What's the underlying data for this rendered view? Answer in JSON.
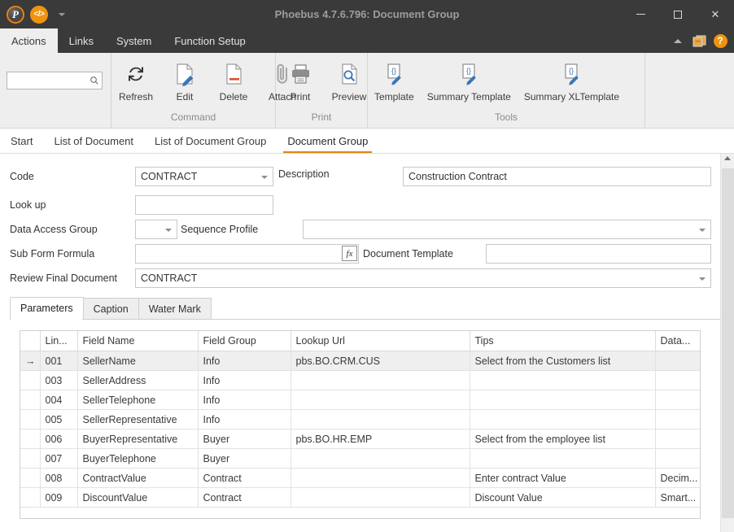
{
  "window": {
    "title": "Phoebus 4.7.6.796: Document Group",
    "minimize_label": "─",
    "maximize_label": "□",
    "close_label": "✕",
    "quick_access": [
      {
        "name": "app-logo-icon",
        "glyph": "P"
      },
      {
        "name": "code-icon",
        "glyph": "</>"
      }
    ]
  },
  "menubar": {
    "items": [
      {
        "label": "Actions",
        "active": true
      },
      {
        "label": "Links",
        "active": false
      },
      {
        "label": "System",
        "active": false
      },
      {
        "label": "Function Setup",
        "active": false
      }
    ],
    "collapse_icon": "chevron-up-icon",
    "windows_icon": "cascade-windows-icon",
    "help_label": "?"
  },
  "ribbon": {
    "search": {
      "value": "",
      "placeholder": "",
      "icon": "search-icon"
    },
    "groups": [
      {
        "title": "Command",
        "buttons": [
          {
            "label": "Refresh",
            "icon": "refresh-icon"
          },
          {
            "label": "Edit",
            "icon": "edit-document-icon"
          },
          {
            "label": "Delete",
            "icon": "delete-document-icon"
          },
          {
            "label": "Attach",
            "icon": "paperclip-icon"
          }
        ]
      },
      {
        "title": "Print",
        "buttons": [
          {
            "label": "Print",
            "icon": "printer-icon"
          },
          {
            "label": "Preview",
            "icon": "print-preview-icon"
          }
        ]
      },
      {
        "title": "Tools",
        "buttons": [
          {
            "label": "Template",
            "icon": "template-edit-icon"
          },
          {
            "label": "Summary Template",
            "icon": "template-edit-icon"
          },
          {
            "label": "Summary XLTemplate",
            "icon": "template-edit-icon"
          }
        ]
      }
    ]
  },
  "document_tabs": [
    {
      "label": "Start",
      "active": false
    },
    {
      "label": "List of Document",
      "active": false
    },
    {
      "label": "List of Document Group",
      "active": false
    },
    {
      "label": "Document Group",
      "active": true
    }
  ],
  "form": {
    "code_label": "Code",
    "code_value": "CONTRACT",
    "description_label": "Description",
    "description_value": "Construction Contract",
    "lookup_label": "Look up",
    "lookup_value": "",
    "data_access_group_label": "Data Access Group",
    "data_access_group_value": "",
    "sequence_profile_label": "Sequence Profile",
    "sequence_profile_value": "",
    "sub_form_formula_label": "Sub Form Formula",
    "sub_form_formula_value": "",
    "formula_button_label": "fx",
    "document_template_label": "Document Template",
    "document_template_value": "",
    "review_final_document_label": "Review Final Document",
    "review_final_document_value": "CONTRACT"
  },
  "inner_tabs": [
    {
      "label": "Parameters",
      "active": true
    },
    {
      "label": "Caption",
      "active": false
    },
    {
      "label": "Water Mark",
      "active": false
    }
  ],
  "grid": {
    "columns": [
      "",
      "Lin...",
      "Field Name",
      "Field Group",
      "Lookup Url",
      "Tips",
      "Data..."
    ],
    "row_marker": "→",
    "rows": [
      {
        "selected": true,
        "line": "001",
        "field_name": "SellerName",
        "field_group": "Info",
        "lookup_url": "pbs.BO.CRM.CUS",
        "tips": "Select from the Customers list",
        "data": ""
      },
      {
        "selected": false,
        "line": "003",
        "field_name": "SellerAddress",
        "field_group": "Info",
        "lookup_url": "",
        "tips": "",
        "data": ""
      },
      {
        "selected": false,
        "line": "004",
        "field_name": "SellerTelephone",
        "field_group": "Info",
        "lookup_url": "",
        "tips": "",
        "data": ""
      },
      {
        "selected": false,
        "line": "005",
        "field_name": "SellerRepresentative",
        "field_group": "Info",
        "lookup_url": "",
        "tips": "",
        "data": ""
      },
      {
        "selected": false,
        "line": "006",
        "field_name": "BuyerRepresentative",
        "field_group": "Buyer",
        "lookup_url": "pbs.BO.HR.EMP",
        "tips": "Select from the employee list",
        "data": ""
      },
      {
        "selected": false,
        "line": "007",
        "field_name": "BuyerTelephone",
        "field_group": "Buyer",
        "lookup_url": "",
        "tips": "",
        "data": ""
      },
      {
        "selected": false,
        "line": "008",
        "field_name": "ContractValue",
        "field_group": "Contract",
        "lookup_url": "",
        "tips": "Enter contract Value",
        "data": "Decim..."
      },
      {
        "selected": false,
        "line": "009",
        "field_name": "DiscountValue",
        "field_group": "Contract",
        "lookup_url": "",
        "tips": "Discount Value",
        "data": "Smart..."
      }
    ]
  },
  "colors": {
    "accent": "#e8820c",
    "titlebar": "#3a3a3a",
    "ribbon": "#eeeeee"
  }
}
